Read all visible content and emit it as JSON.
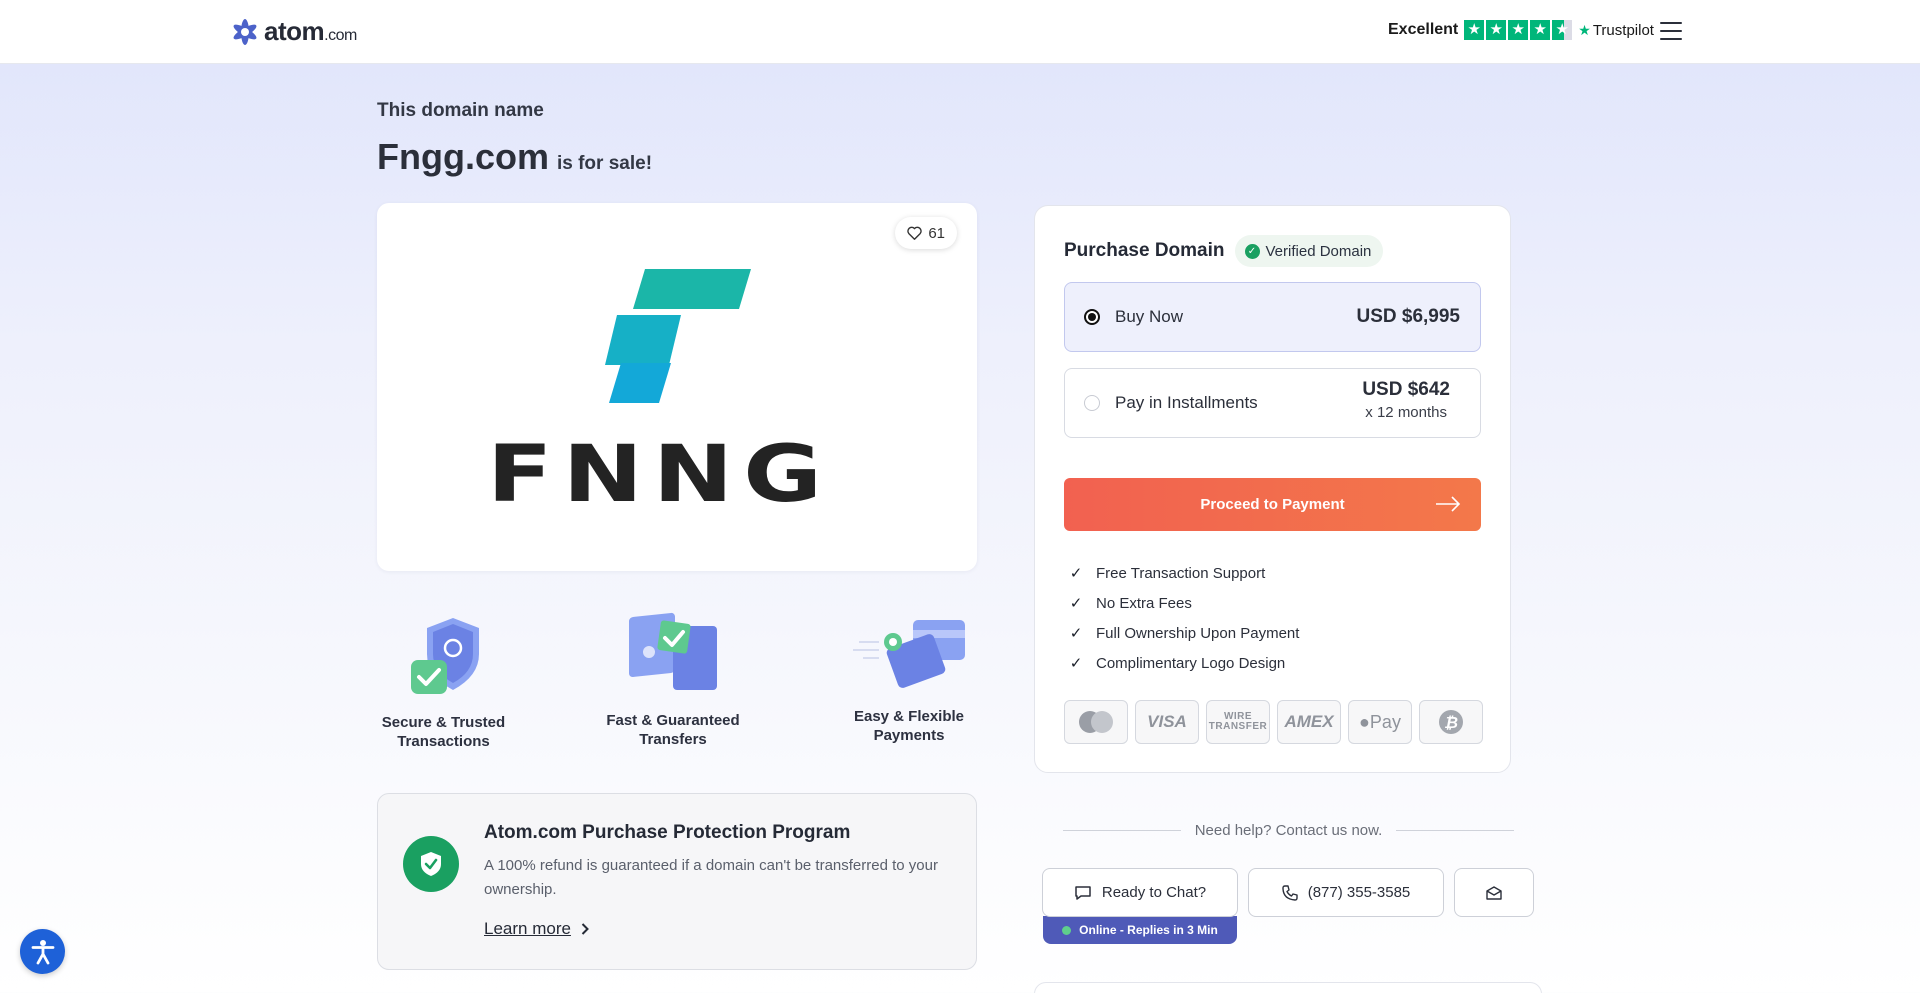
{
  "header": {
    "logo_text": "atom",
    "logo_suffix": ".com",
    "trustpilot": {
      "rating_label": "Excellent",
      "brand": "Trustpilot",
      "stars": 4.5,
      "star_color": "#00b67a"
    },
    "menu_icon": "hamburger-menu-icon"
  },
  "hero": {
    "intro": "This domain name",
    "domain": "Fngg.com",
    "sale_text": "is for sale!"
  },
  "logo_card": {
    "likes": "61",
    "wordmark": "FNNG",
    "mark_colors": [
      "#1bb6a8",
      "#13a8d8"
    ]
  },
  "features": [
    {
      "label": "Secure & Trusted Transactions",
      "icon": "shield-check-icon"
    },
    {
      "label": "Fast & Guaranteed Transfers",
      "icon": "wallet-check-icon"
    },
    {
      "label": "Easy & Flexible Payments",
      "icon": "cards-icon"
    }
  ],
  "protection": {
    "title": "Atom.com Purchase Protection Program",
    "description": "A 100% refund is guaranteed if a domain can't be transferred to your ownership.",
    "link": "Learn more"
  },
  "purchase": {
    "title": "Purchase Domain",
    "verified": "Verified Domain",
    "options": [
      {
        "label": "Buy Now",
        "price": "USD $6,995",
        "selected": true
      },
      {
        "label": "Pay in Installments",
        "price": "USD $642",
        "period": "x 12 months",
        "selected": false
      }
    ],
    "cta": "Proceed to Payment",
    "accent": "#f26150",
    "benefits": [
      "Free Transaction Support",
      "No Extra Fees",
      "Full Ownership Upon Payment",
      "Complimentary Logo Design"
    ],
    "payment_methods": {
      "mastercard": "mastercard-icon",
      "visa": "VISA",
      "wire": "WIRE TRANSFER",
      "amex": "AMEX",
      "applepay": "Pay",
      "bitcoin": "bitcoin-icon"
    }
  },
  "contact": {
    "help": "Need help? Contact us now.",
    "chat": "Ready to Chat?",
    "phone": "(877) 355-3585",
    "online": "Online - Replies in 3 Min",
    "email_icon": "mail-icon"
  }
}
